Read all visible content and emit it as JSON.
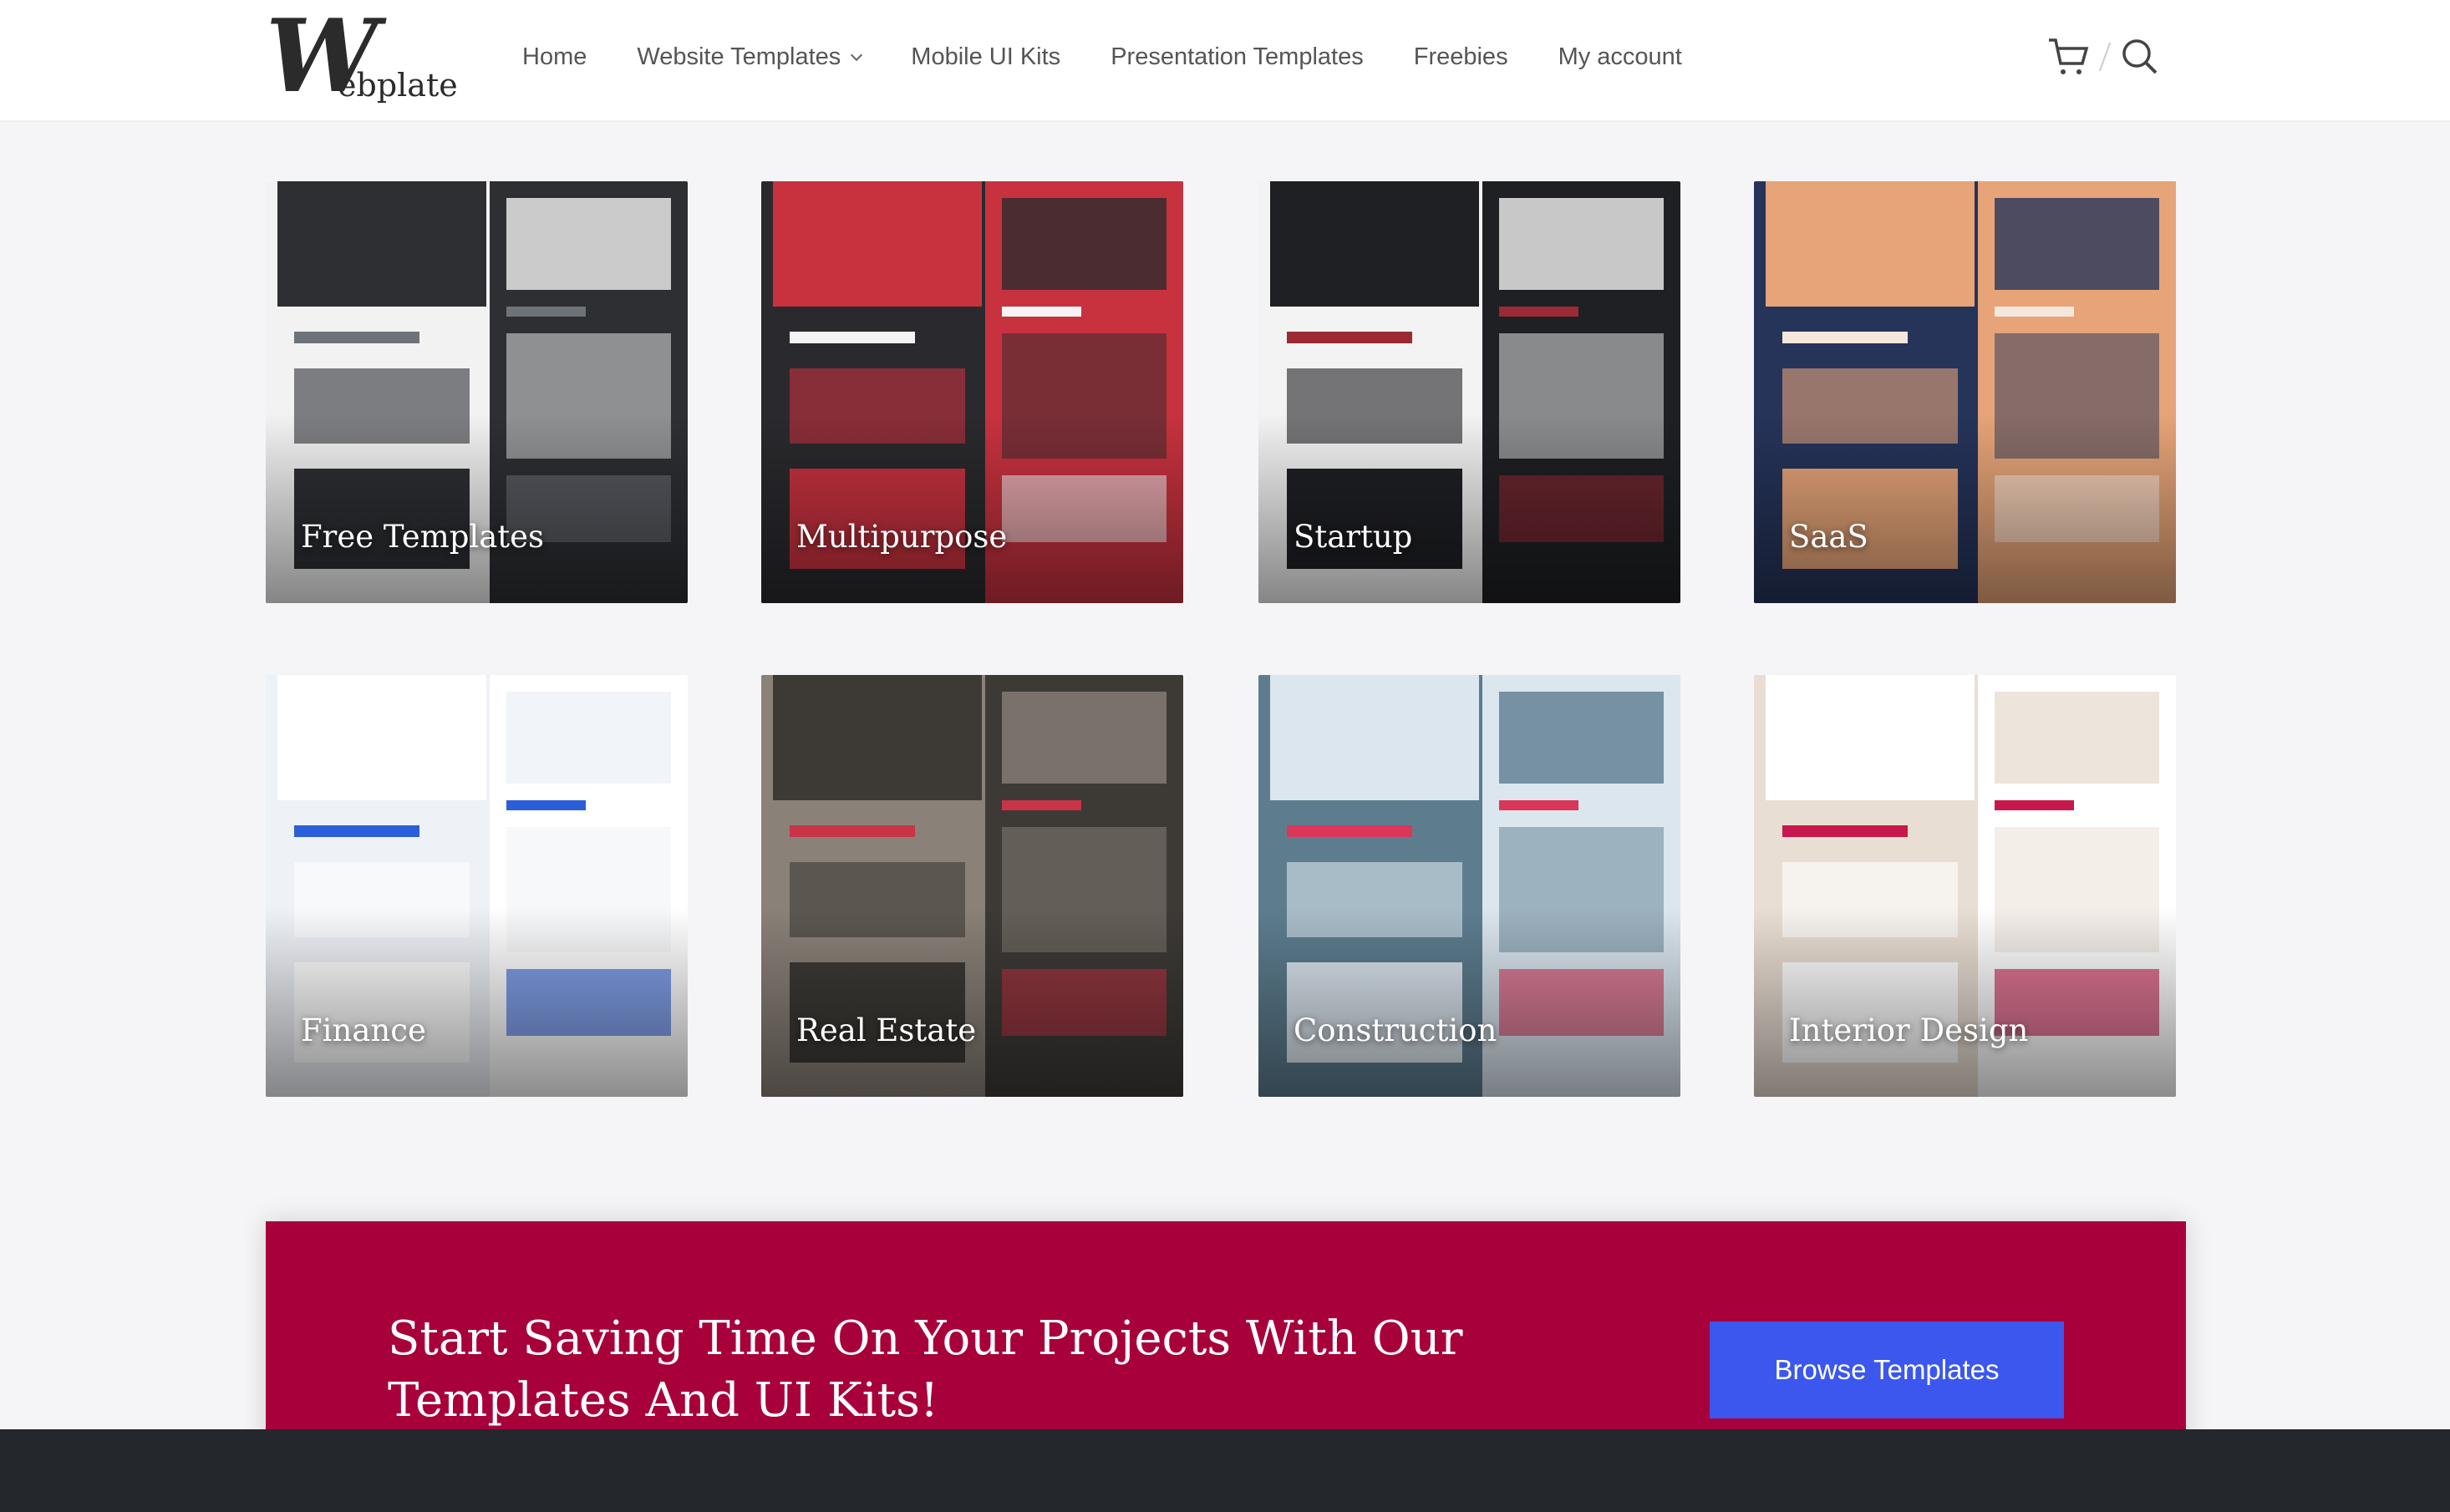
{
  "brand": {
    "logo_initial": "W",
    "logo_rest": "ebplate"
  },
  "nav": {
    "items": [
      "Home",
      "Website Templates",
      "Mobile UI Kits",
      "Presentation Templates",
      "Freebies",
      "My account"
    ]
  },
  "header_icons": [
    "cart-icon",
    "search-icon"
  ],
  "categories": [
    {
      "label": "Free Templates",
      "theme": [
        "#2d2f33",
        "#f2f2f2",
        "#6e7379"
      ]
    },
    {
      "label": "Multipurpose",
      "theme": [
        "#c8323f",
        "#2a2a2e",
        "#f4f4f4"
      ]
    },
    {
      "label": "Startup",
      "theme": [
        "#1f2024",
        "#f3f3f3",
        "#9b2a35"
      ]
    },
    {
      "label": "SaaS",
      "theme": [
        "#e6a478",
        "#26345a",
        "#f6e7dc"
      ]
    },
    {
      "label": "Finance",
      "theme": [
        "#ffffff",
        "#eef1f6",
        "#2b5fd9"
      ]
    },
    {
      "label": "Real Estate",
      "theme": [
        "#3d3a36",
        "#8a8178",
        "#c93446"
      ]
    },
    {
      "label": "Construction",
      "theme": [
        "#dbe6ef",
        "#5d7d8f",
        "#d9365a"
      ]
    },
    {
      "label": "Interior Design",
      "theme": [
        "#ffffff",
        "#e9ded3",
        "#c8174d"
      ]
    }
  ],
  "cta": {
    "title": "Start Saving Time On Your Projects With Our Templates And UI Kits!",
    "button": "Browse Templates",
    "bg": "#a8003a",
    "button_color": "#3b57ee"
  }
}
